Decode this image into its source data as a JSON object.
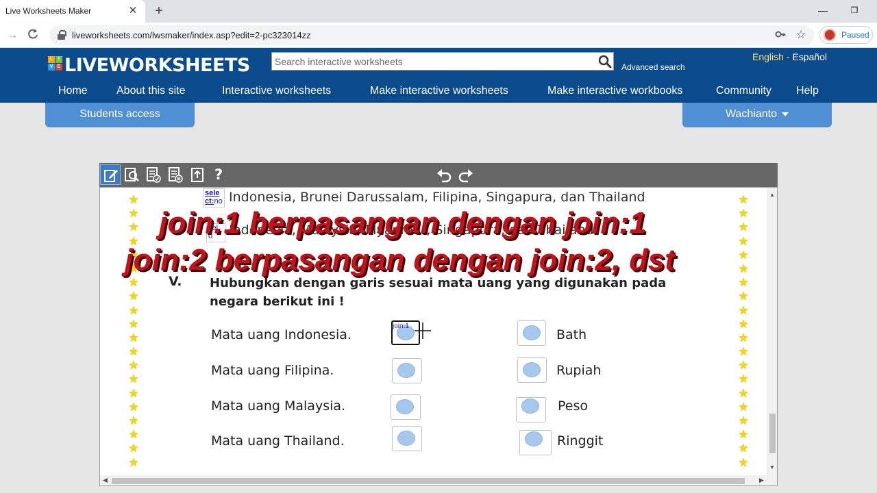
{
  "browser": {
    "tab_title": "Live Worksheets Maker",
    "tab_close": "✕",
    "new_tab": "+",
    "window_minimize": "—",
    "window_restore": "❐",
    "back": "→",
    "reload": "C",
    "url": "liveworksheets.com/lwsmaker/index.asp?edit=2-pc323014zz",
    "key_icon": "⚿",
    "bookmark_icon": "☆",
    "profile_status": "Paused"
  },
  "site": {
    "logo_letters": [
      "L",
      "I",
      "V",
      "E"
    ],
    "logo_colors": [
      "#f4a300",
      "#6cc04a",
      "#2e9be0",
      "#e8402f"
    ],
    "logo_text": "LIVEWORKSHEETS",
    "search_placeholder": "Search interactive worksheets",
    "advanced_search": "Advanced search",
    "lang_english": "English",
    "lang_sep": "-",
    "lang_espanol": "Español",
    "menu": [
      "Home",
      "About this site",
      "Interactive worksheets",
      "Make interactive worksheets",
      "Make interactive workbooks",
      "Community",
      "Help"
    ],
    "students_access": "Students access",
    "user_name": "Wachianto"
  },
  "editor": {
    "tools": [
      "edit-icon",
      "preview-icon",
      "save-check-icon",
      "delete-icon",
      "upload-icon",
      "help-icon"
    ],
    "help_label": "?",
    "undo_icon": "undo-icon",
    "redo_icon": "redo-icon",
    "scroll_up": "▲",
    "scroll_down": "▼",
    "scroll_left": "◀",
    "scroll_right": "▶"
  },
  "worksheet": {
    "line1": "Indonesia, Brunei Darussalam, Filipina, Singapura, dan Thailand",
    "line2": "Indonesia, Malaysia, Myanmar, Singapura, dan Thailand",
    "select_box_1": [
      "sele",
      "ct:",
      "no"
    ],
    "select_box_2": [
      "sel",
      "o"
    ],
    "question_number": "V.",
    "question_line1": "Hubungkan dengan garis sesuai mata uang yang digunakan pada",
    "question_line2": "negara berikut ini !",
    "left_items": [
      "Mata uang Indonesia.",
      "Mata uang Filipina.",
      "Mata uang Malaysia.",
      "Mata uang Thailand."
    ],
    "right_items": [
      "Bath",
      "Rupiah",
      "Peso",
      "Ringgit"
    ],
    "active_join_label": "join:1",
    "star": "★"
  },
  "overlay": {
    "line1": "join:1 berpasangan dengan join:1",
    "line2": "join:2 berpasangan dengan join:2, dst"
  }
}
